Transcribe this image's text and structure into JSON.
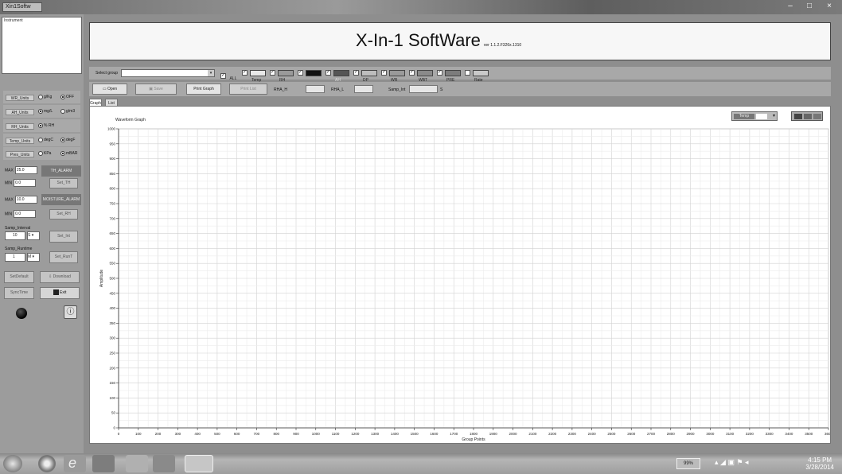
{
  "window": {
    "app_tab": "Xin1Softw",
    "minimize": "–",
    "maximize": "□",
    "close": "×"
  },
  "left_panel": {
    "instrument_label": "Instrument",
    "units": [
      {
        "label": "WR_Units",
        "opt1": "g/Kg",
        "opt2": "OFF",
        "selected": 2
      },
      {
        "label": "AH_Units",
        "opt1": "mg/L",
        "opt2": "g/m3",
        "selected": 1
      },
      {
        "label": "RH_Units",
        "opt1": "% RH",
        "opt2": "",
        "selected": 1
      },
      {
        "label": "Temp_Units",
        "opt1": "degC",
        "opt2": "degF",
        "selected": 2
      },
      {
        "label": "Pres_Units",
        "opt1": "KPa",
        "opt2": "mBAR",
        "selected": 2
      }
    ],
    "max_label": "MAX",
    "min_label": "MIN",
    "th_max": "25.0",
    "th_min": "0.0",
    "th_alarm_header": "TH_ALARM",
    "set_th_button": "Set_TH",
    "moist_max": "10.0",
    "moist_min": "0.0",
    "moisture_alarm_header": "MOISTURE_ALARM",
    "set_rh_button": "Set_RH",
    "samp_interval_label": "Samp_Interval",
    "samp_interval_value": "10",
    "samp_interval_unit": "S",
    "samp_runtime_label": "Samp_Runtime",
    "samp_runtime_value": "1",
    "samp_runtime_unit": "M",
    "set_int_button": "Set_Int",
    "set_runT_button": "Set_RunT",
    "set_default_button": "SetDefault",
    "download_button": "Download",
    "sync_time_button": "SyncTime",
    "exit_button": "Exit"
  },
  "header": {
    "title": "X-In-1 SoftWare",
    "version": "ver 1.1.2.F326x.1310"
  },
  "toolbar1": {
    "select_group_label": "Select group",
    "select_group_value": "",
    "all_label": "ALL",
    "items": [
      {
        "label": "Temp",
        "color": "#e8e8e8",
        "checked": true
      },
      {
        "label": "RH",
        "color": "#9a9a9a",
        "checked": true
      },
      {
        "label": "",
        "color": "#111111",
        "checked": true
      },
      {
        "label": "AH",
        "color": "#555555",
        "checked": true
      },
      {
        "label": "DP",
        "color": "#bdbdbd",
        "checked": true
      },
      {
        "label": "WR",
        "color": "#9a9a9a",
        "checked": true
      },
      {
        "label": "WBT",
        "color": "#8a8a8a",
        "checked": true
      },
      {
        "label": "PRE",
        "color": "#7c7c7c",
        "checked": true
      },
      {
        "label": "Rate",
        "color": "#c9c9c9",
        "checked": false
      }
    ]
  },
  "toolbar2": {
    "open_button": "Open",
    "save_button": "Save",
    "print_graph_button": "Print Graph",
    "print_list_button": "Print List",
    "high_label": "RHA_H",
    "low_label": "RHA_L",
    "samp_int_label": "Samp_Int",
    "samp_int_unit": "S"
  },
  "tabs": [
    {
      "label": "Graph"
    },
    {
      "label": "List"
    }
  ],
  "chart_toolbar": {
    "dropdown": "Temp"
  },
  "chart_data": {
    "type": "line",
    "title": "Waveform Graph",
    "xlabel": "Group Points",
    "ylabel": "Amplitude",
    "xlim": [
      0,
      3600
    ],
    "ylim": [
      0,
      1000
    ],
    "xticks": [
      "0",
      "100",
      "200",
      "300",
      "400",
      "500",
      "600",
      "700",
      "800",
      "900",
      "1000",
      "1100",
      "1200",
      "1300",
      "1400",
      "1500",
      "1600",
      "1700",
      "1800",
      "1900",
      "2000",
      "2100",
      "2200",
      "2300",
      "2400",
      "2500",
      "2600",
      "2700",
      "2800",
      "2900",
      "3000",
      "3100",
      "3200",
      "3300",
      "3400",
      "3500",
      "3600"
    ],
    "yticks": [
      "0",
      "50",
      "100",
      "150",
      "200",
      "250",
      "300",
      "350",
      "400",
      "450",
      "500",
      "550",
      "600",
      "650",
      "700",
      "750",
      "800",
      "850",
      "900",
      "950",
      "1000"
    ],
    "series": [],
    "grid": true
  },
  "taskbar": {
    "zoom": "99%",
    "time": "4:15 PM",
    "date": "3/28/2014"
  }
}
